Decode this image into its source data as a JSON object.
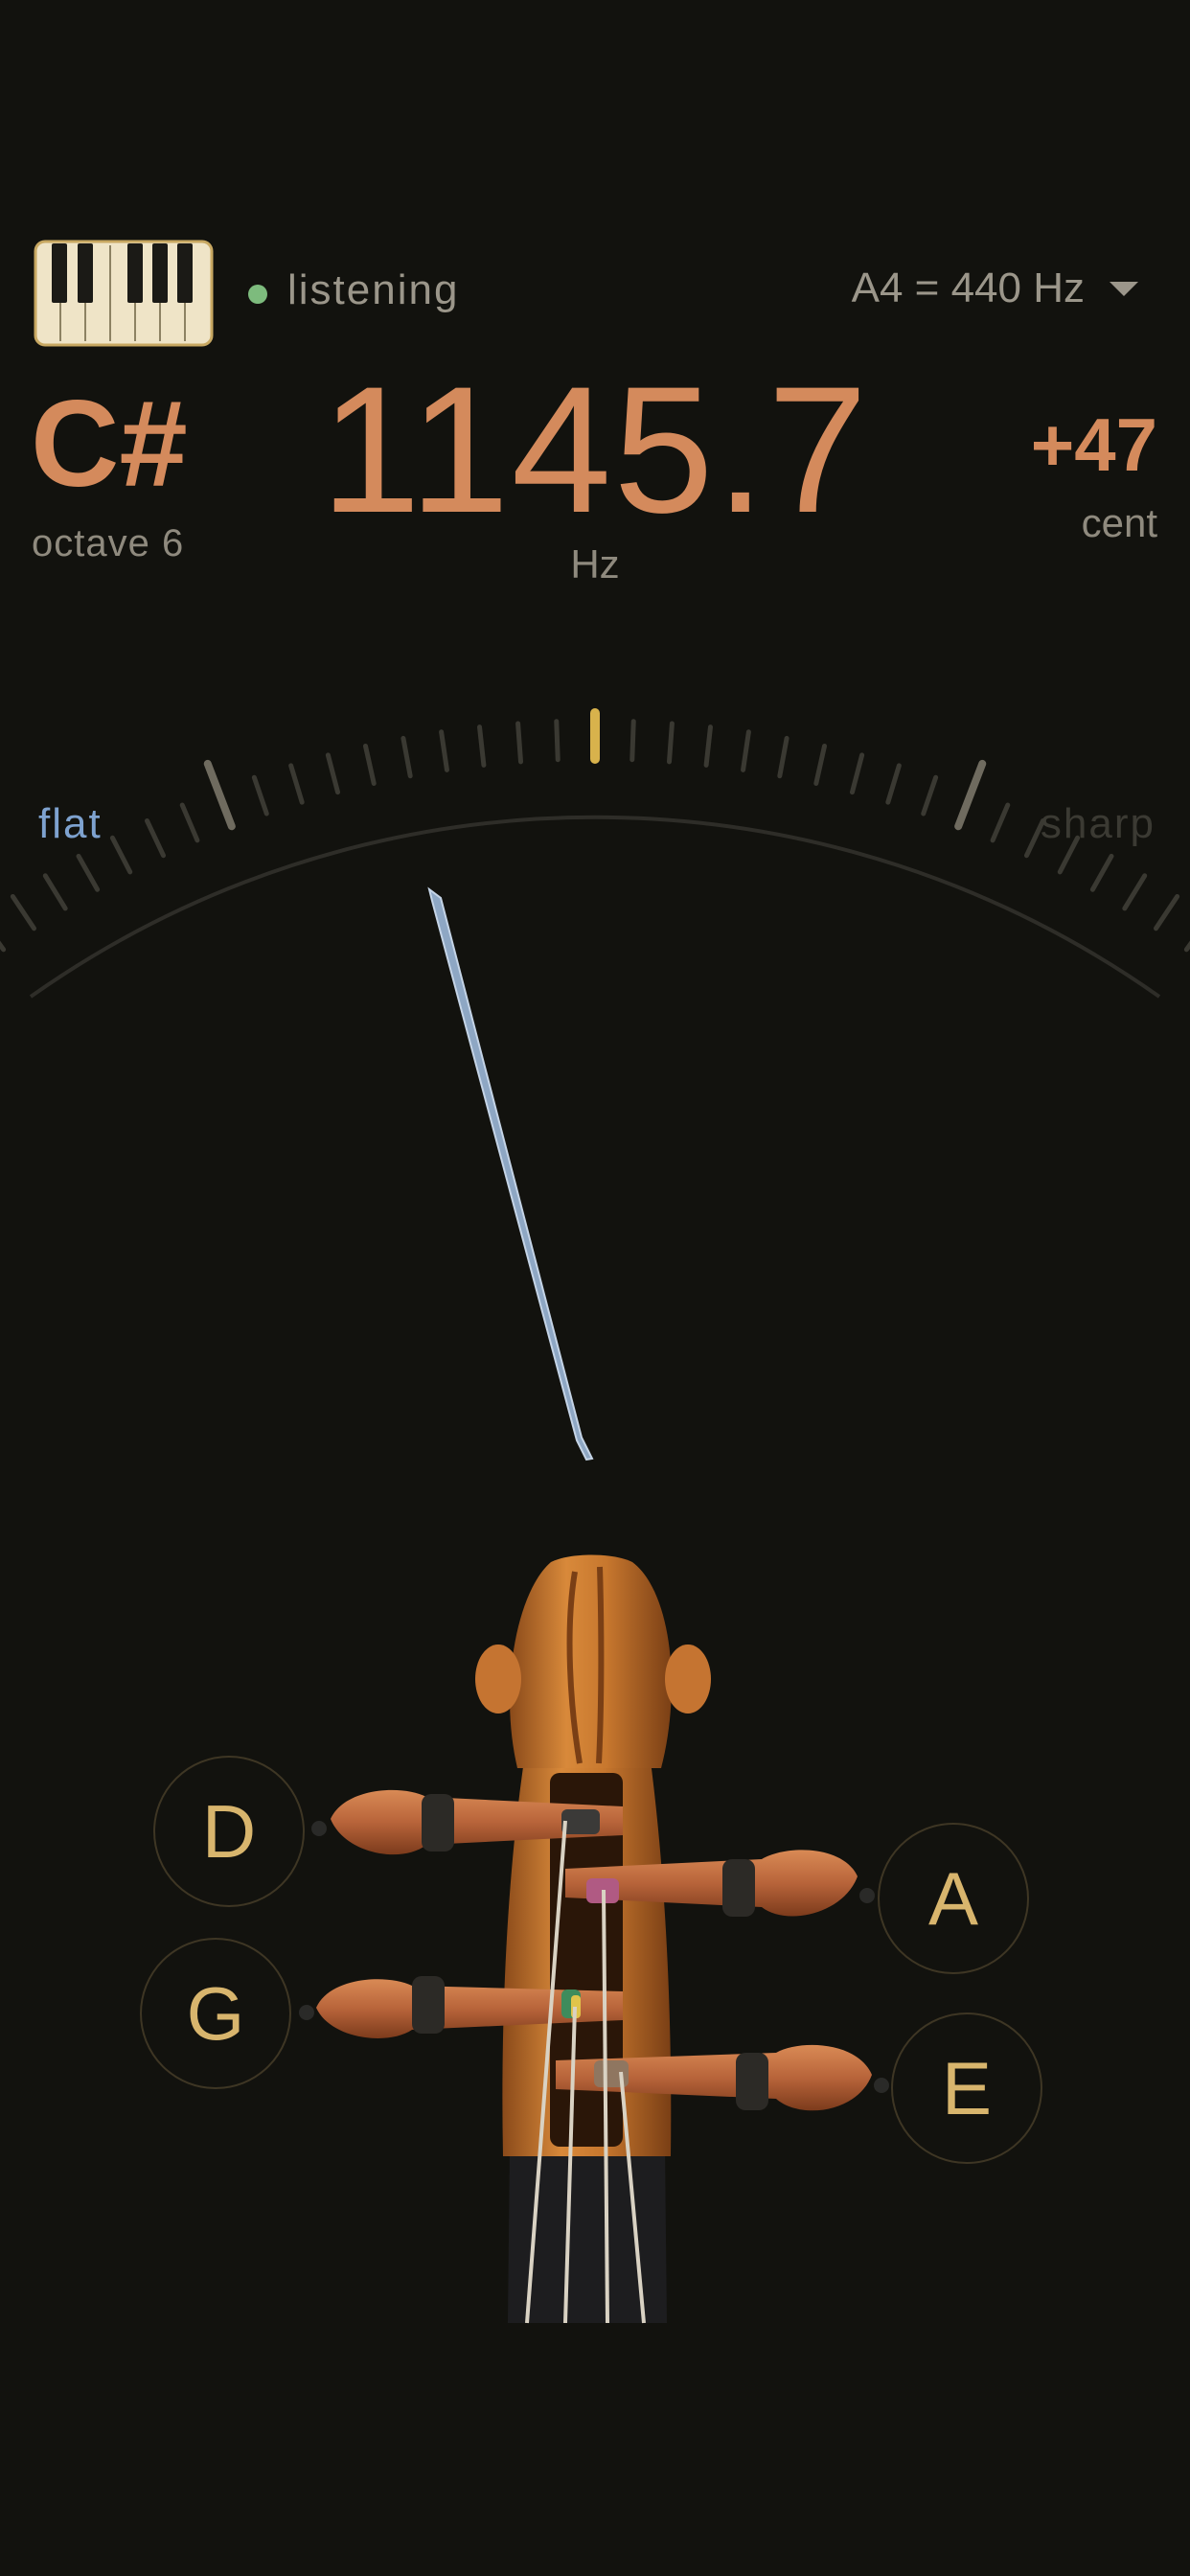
{
  "header": {
    "status": "listening",
    "reference": "A4 = 440 Hz"
  },
  "reading": {
    "note": "C#",
    "octave": "octave 6",
    "frequency": "1145.7",
    "frequency_unit": "Hz",
    "cents": "+47",
    "cents_unit": "cent"
  },
  "meter": {
    "flat_label": "flat",
    "sharp_label": "sharp",
    "needle_cents": -10
  },
  "strings": {
    "d": "D",
    "a": "A",
    "g": "G",
    "e": "E"
  },
  "colors": {
    "background": "#12120e",
    "accent": "#d48a5c",
    "needle": "#8ea7c4",
    "center_tick": "#d8b24c",
    "string_label": "#d8b56d",
    "status_dot": "#7dbb7d"
  },
  "icons": {
    "piano": "piano-keyboard-icon",
    "dropdown": "chevron-down-icon"
  }
}
